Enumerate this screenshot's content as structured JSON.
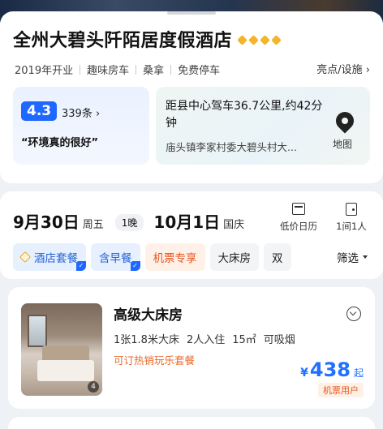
{
  "hotel": {
    "name": "全州大碧头阡陌居度假酒店",
    "tags": [
      "2019年开业",
      "趣味房车",
      "桑拿",
      "免费停车"
    ],
    "facilities_link": "亮点/设施",
    "rating": {
      "score": "4.3",
      "review_count": "339条",
      "quote": "“环境真的很好”"
    },
    "location": {
      "distance": "距县中心驾车36.7公里,约42分钟",
      "address": "庙头镇李家村委大碧头村大...",
      "map_label": "地图"
    }
  },
  "booking": {
    "checkin_date": "9月30日",
    "checkin_weekday": "周五",
    "nights": "1晚",
    "checkout_date": "10月1日",
    "checkout_weekday": "国庆",
    "calendar_label": "低价日历",
    "room_label": "1间1人",
    "filters": [
      {
        "label": "酒店套餐",
        "style": "blue",
        "checked": true
      },
      {
        "label": "含早餐",
        "style": "blue",
        "checked": true
      },
      {
        "label": "机票专享",
        "style": "orange",
        "checked": false
      },
      {
        "label": "大床房",
        "style": "gray",
        "checked": false
      },
      {
        "label": "双",
        "style": "gray",
        "checked": false
      }
    ],
    "filter_button": "筛选"
  },
  "room": {
    "name": "高级大床房",
    "specs": [
      "1张1.8米大床",
      "2人入住",
      "15㎡",
      "可吸烟"
    ],
    "promo": "可订热销玩乐套餐",
    "photo_count": "4",
    "price_currency": "¥",
    "price": "438",
    "price_suffix": "起",
    "price_tag": "机票用户"
  },
  "colors": {
    "accent_blue": "#1f68ff",
    "accent_orange": "#e8551d",
    "star": "#f3b52a"
  }
}
